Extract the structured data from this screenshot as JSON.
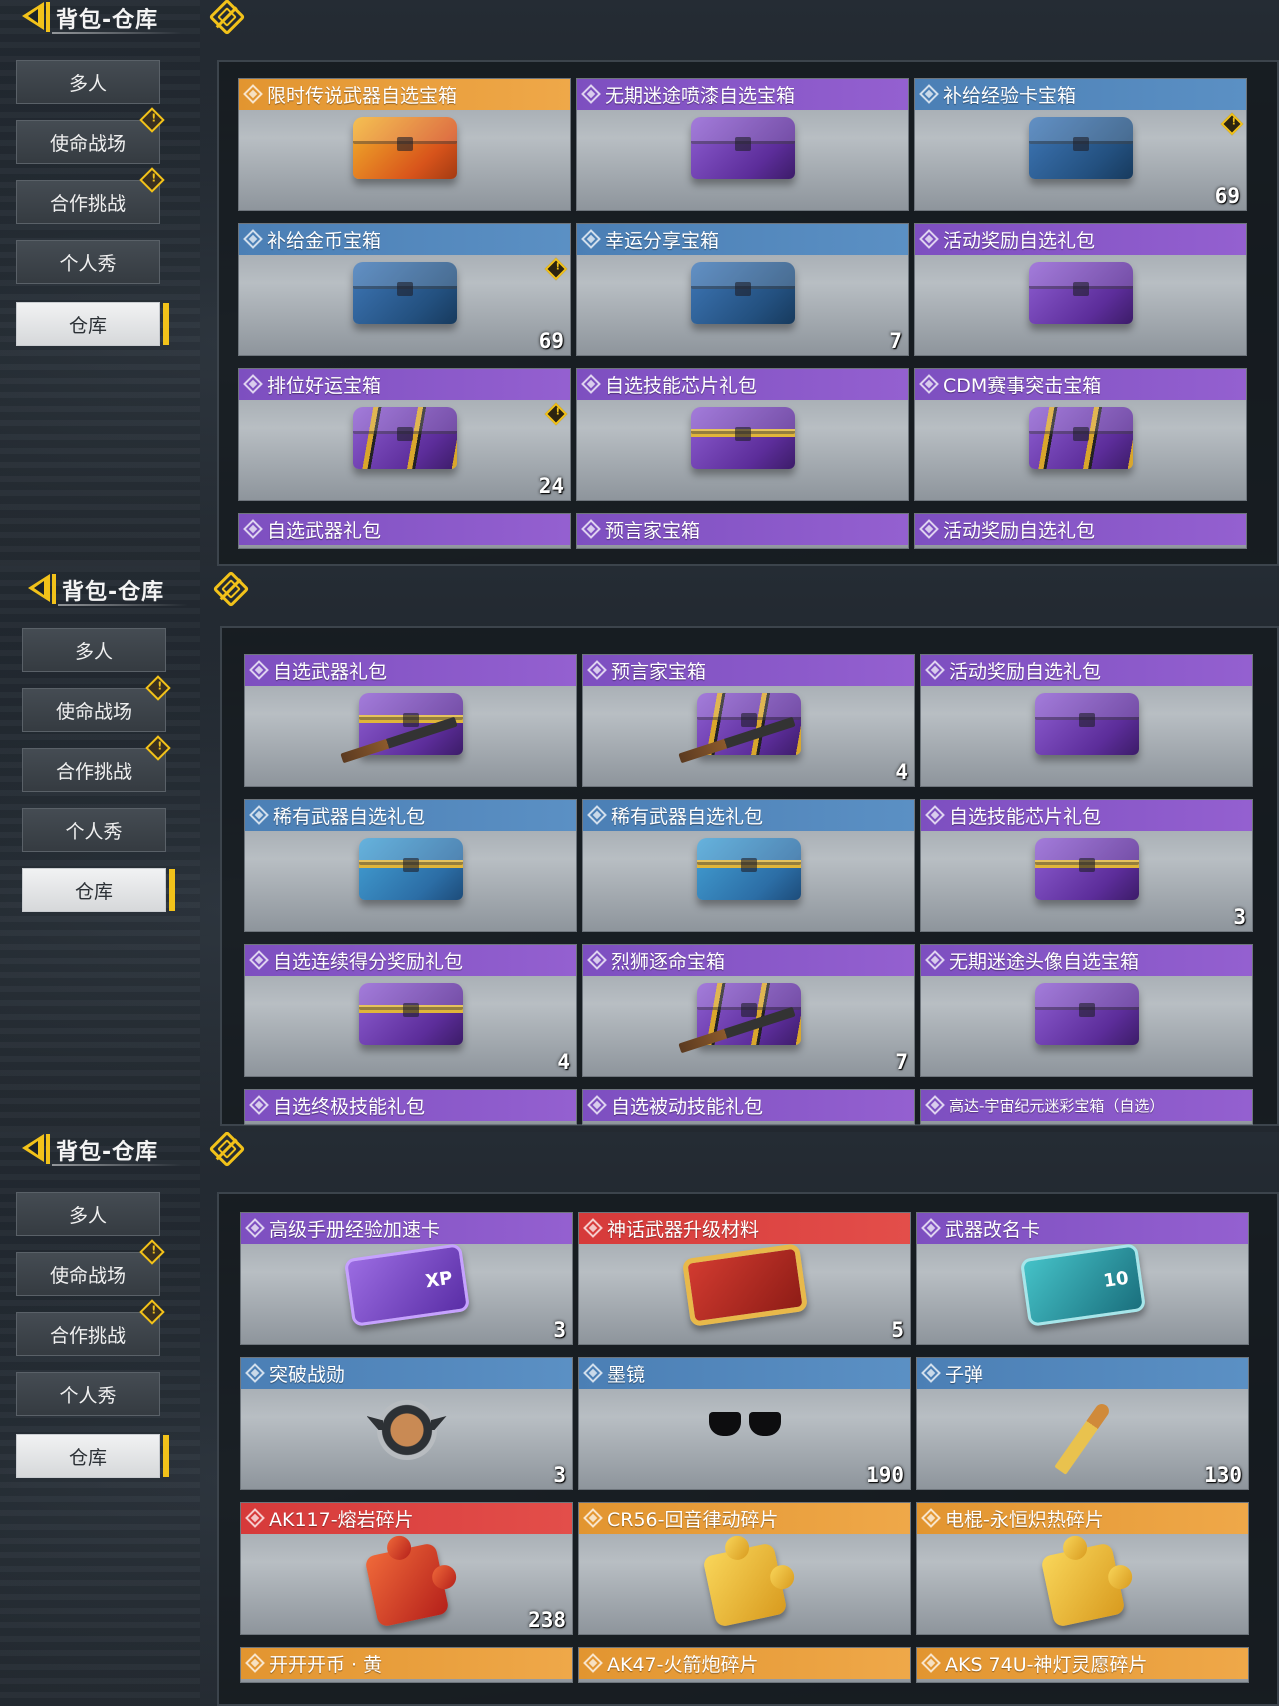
{
  "panels": [
    {
      "title": "背包-仓库",
      "nav": [
        {
          "label": "多人",
          "alert": false,
          "active": false
        },
        {
          "label": "使命战场",
          "alert": true,
          "active": false
        },
        {
          "label": "合作挑战",
          "alert": true,
          "active": false
        },
        {
          "label": "个人秀",
          "alert": false,
          "active": false
        },
        {
          "label": "仓库",
          "alert": false,
          "active": true
        }
      ],
      "items": [
        {
          "name": "限时传说武器自选宝箱",
          "rarity": "orange",
          "count": "",
          "alert": false,
          "art": "chest-orange"
        },
        {
          "name": "无期迷途喷漆自选宝箱",
          "rarity": "purple",
          "count": "",
          "alert": false,
          "art": "chest-purple"
        },
        {
          "name": "补给经验卡宝箱",
          "rarity": "blue",
          "count": "69",
          "alert": true,
          "art": "chest-blue"
        },
        {
          "name": "补给金币宝箱",
          "rarity": "blue",
          "count": "69",
          "alert": true,
          "art": "chest-blue"
        },
        {
          "name": "幸运分享宝箱",
          "rarity": "blue",
          "count": "7",
          "alert": false,
          "art": "chest-blue"
        },
        {
          "name": "活动奖励自选礼包",
          "rarity": "purple",
          "count": "",
          "alert": false,
          "art": "chest-purple"
        },
        {
          "name": "排位好运宝箱",
          "rarity": "purple",
          "count": "24",
          "alert": true,
          "art": "chest-strapped"
        },
        {
          "name": "自选技能芯片礼包",
          "rarity": "purple",
          "count": "",
          "alert": false,
          "art": "case-gold"
        },
        {
          "name": "CDM赛事突击宝箱",
          "rarity": "purple",
          "count": "",
          "alert": false,
          "art": "chest-strapped"
        },
        {
          "name": "自选武器礼包",
          "rarity": "purple",
          "count": "",
          "alert": false,
          "art": "none"
        },
        {
          "name": "预言家宝箱",
          "rarity": "purple",
          "count": "",
          "alert": false,
          "art": "none"
        },
        {
          "name": "活动奖励自选礼包",
          "rarity": "purple",
          "count": "",
          "alert": false,
          "art": "none"
        }
      ]
    },
    {
      "title": "背包-仓库",
      "nav": [
        {
          "label": "多人",
          "alert": false,
          "active": false
        },
        {
          "label": "使命战场",
          "alert": true,
          "active": false
        },
        {
          "label": "合作挑战",
          "alert": true,
          "active": false
        },
        {
          "label": "个人秀",
          "alert": false,
          "active": false
        },
        {
          "label": "仓库",
          "alert": false,
          "active": true
        }
      ],
      "items": [
        {
          "name": "自选武器礼包",
          "rarity": "purple",
          "count": "",
          "alert": false,
          "art": "case-gold-gun"
        },
        {
          "name": "预言家宝箱",
          "rarity": "purple",
          "count": "4",
          "alert": false,
          "art": "chest-strapped-gun"
        },
        {
          "name": "活动奖励自选礼包",
          "rarity": "purple",
          "count": "",
          "alert": false,
          "art": "chest-purple"
        },
        {
          "name": "稀有武器自选礼包",
          "rarity": "blue",
          "count": "",
          "alert": false,
          "art": "case-blue"
        },
        {
          "name": "稀有武器自选礼包",
          "rarity": "blue",
          "count": "",
          "alert": false,
          "art": "case-blue"
        },
        {
          "name": "自选技能芯片礼包",
          "rarity": "purple",
          "count": "3",
          "alert": false,
          "art": "case-gold"
        },
        {
          "name": "自选连续得分奖励礼包",
          "rarity": "purple",
          "count": "4",
          "alert": false,
          "art": "case-gold"
        },
        {
          "name": "烈狮逐命宝箱",
          "rarity": "purple",
          "count": "7",
          "alert": false,
          "art": "chest-strapped-gun"
        },
        {
          "name": "无期迷途头像自选宝箱",
          "rarity": "purple",
          "count": "",
          "alert": false,
          "art": "chest-purple"
        },
        {
          "name": "自选终极技能礼包",
          "rarity": "purple",
          "count": "",
          "alert": false,
          "art": "none"
        },
        {
          "name": "自选被动技能礼包",
          "rarity": "purple",
          "count": "",
          "alert": false,
          "art": "none"
        },
        {
          "name": "高达-宇宙纪元迷彩宝箱（自选）",
          "rarity": "purple",
          "count": "",
          "alert": false,
          "art": "none",
          "small": true
        }
      ]
    },
    {
      "title": "背包-仓库",
      "nav": [
        {
          "label": "多人",
          "alert": false,
          "active": false
        },
        {
          "label": "使命战场",
          "alert": true,
          "active": false
        },
        {
          "label": "合作挑战",
          "alert": true,
          "active": false
        },
        {
          "label": "个人秀",
          "alert": false,
          "active": false
        },
        {
          "label": "仓库",
          "alert": false,
          "active": true
        }
      ],
      "items": [
        {
          "name": "高级手册经验加速卡",
          "rarity": "purple",
          "count": "3",
          "alert": false,
          "art": "card-purple",
          "art_text": "XP"
        },
        {
          "name": "神话武器升级材料",
          "rarity": "red",
          "count": "5",
          "alert": false,
          "art": "card-red"
        },
        {
          "name": "武器改名卡",
          "rarity": "purple",
          "count": "",
          "alert": false,
          "art": "card-teal",
          "art_text": "10"
        },
        {
          "name": "突破战勋",
          "rarity": "blue",
          "count": "3",
          "alert": false,
          "art": "badge"
        },
        {
          "name": "墨镜",
          "rarity": "blue",
          "count": "190",
          "alert": false,
          "art": "glasses"
        },
        {
          "name": "子弹",
          "rarity": "blue",
          "count": "130",
          "alert": false,
          "art": "bullet"
        },
        {
          "name": "AK117-熔岩碎片",
          "rarity": "red",
          "count": "238",
          "alert": false,
          "art": "puzzle-red"
        },
        {
          "name": "CR56-回音律动碎片",
          "rarity": "orange",
          "count": "",
          "alert": false,
          "art": "puzzle-gold"
        },
        {
          "name": "电棍-永恒炽热碎片",
          "rarity": "orange",
          "count": "",
          "alert": false,
          "art": "puzzle-gold"
        },
        {
          "name": "开开开币 · 黄",
          "rarity": "orange",
          "count": "",
          "alert": false,
          "art": "none"
        },
        {
          "name": "AK47-火箭炮碎片",
          "rarity": "orange",
          "count": "",
          "alert": false,
          "art": "none"
        },
        {
          "name": "AKS 74U-神灯灵愿碎片",
          "rarity": "orange",
          "count": "",
          "alert": false,
          "art": "none"
        }
      ]
    }
  ]
}
